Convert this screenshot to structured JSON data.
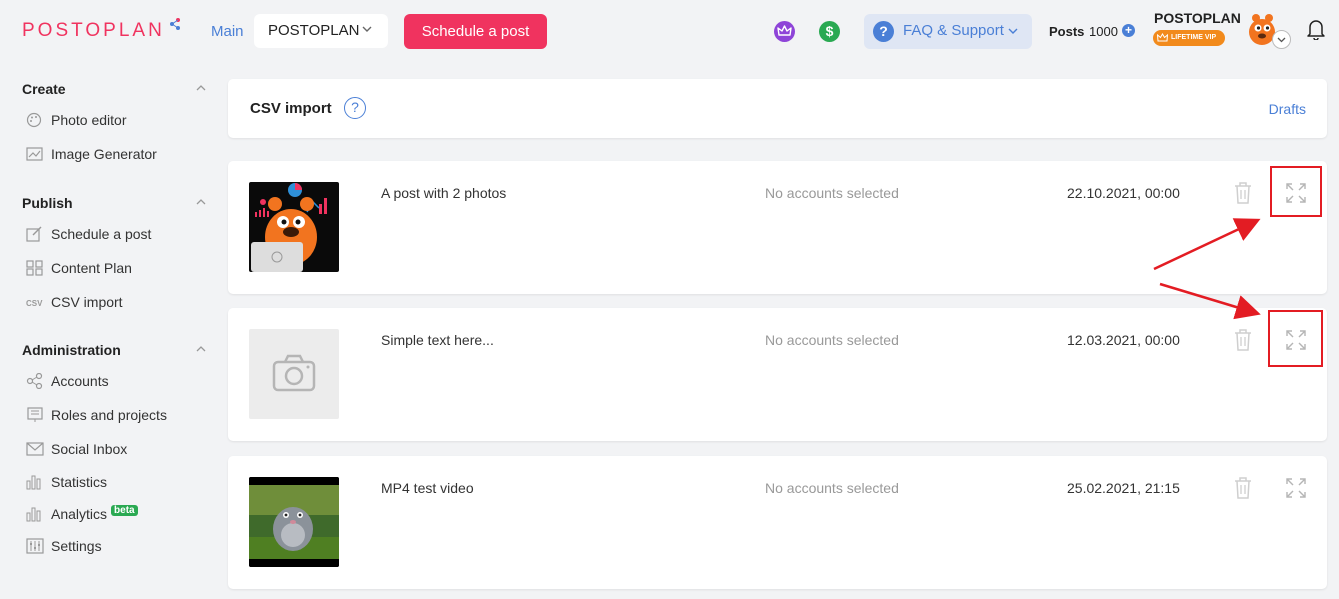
{
  "header": {
    "logo_text": "POSTOPLAN",
    "nav_main": "Main",
    "project_selector": "POSTOPLAN",
    "schedule_button": "Schedule a post",
    "faq_label": "FAQ & Support",
    "posts_label": "Posts",
    "posts_count": "1000",
    "account_name": "POSTOPLAN",
    "vip_badge": "LIFETIME VIP",
    "icons": [
      "share-icon",
      "crown-icon",
      "dollar-icon",
      "question-icon",
      "plus-icon",
      "bell-icon",
      "chevron-down-icon"
    ],
    "colors": {
      "brand": "#f0335f",
      "link": "#4a7fd6",
      "vip": "#f28a1c"
    }
  },
  "sidebar": {
    "sections": [
      {
        "title": "Create",
        "items": [
          {
            "label": "Photo editor",
            "icon": "palette-icon"
          },
          {
            "label": "Image Generator",
            "icon": "image-chart-icon"
          }
        ]
      },
      {
        "title": "Publish",
        "items": [
          {
            "label": "Schedule a post",
            "icon": "edit-icon"
          },
          {
            "label": "Content Plan",
            "icon": "grid-icon"
          },
          {
            "label": "CSV import",
            "icon": "csv-icon"
          }
        ]
      },
      {
        "title": "Administration",
        "items": [
          {
            "label": "Accounts",
            "icon": "share-nodes-icon"
          },
          {
            "label": "Roles and projects",
            "icon": "board-icon"
          },
          {
            "label": "Social Inbox",
            "icon": "envelope-icon"
          },
          {
            "label": "Statistics",
            "icon": "bar-chart-icon"
          },
          {
            "label": "Analytics",
            "icon": "bar-chart-icon",
            "badge": "beta"
          },
          {
            "label": "Settings",
            "icon": "sliders-icon"
          }
        ]
      }
    ]
  },
  "main": {
    "title": "CSV import",
    "help_icon": "?",
    "drafts_link": "Drafts",
    "posts": [
      {
        "title": "A post with 2 photos",
        "accounts": "No accounts selected",
        "date": "22.10.2021, 00:00",
        "thumb": "mascot-image"
      },
      {
        "title": "Simple text here...",
        "accounts": "No accounts selected",
        "date": "12.03.2021, 00:00",
        "thumb": "camera-placeholder"
      },
      {
        "title": "MP4 test video",
        "accounts": "No accounts selected",
        "date": "25.02.2021, 21:15",
        "thumb": "video-still"
      }
    ],
    "annotation_color": "#e31c23"
  }
}
